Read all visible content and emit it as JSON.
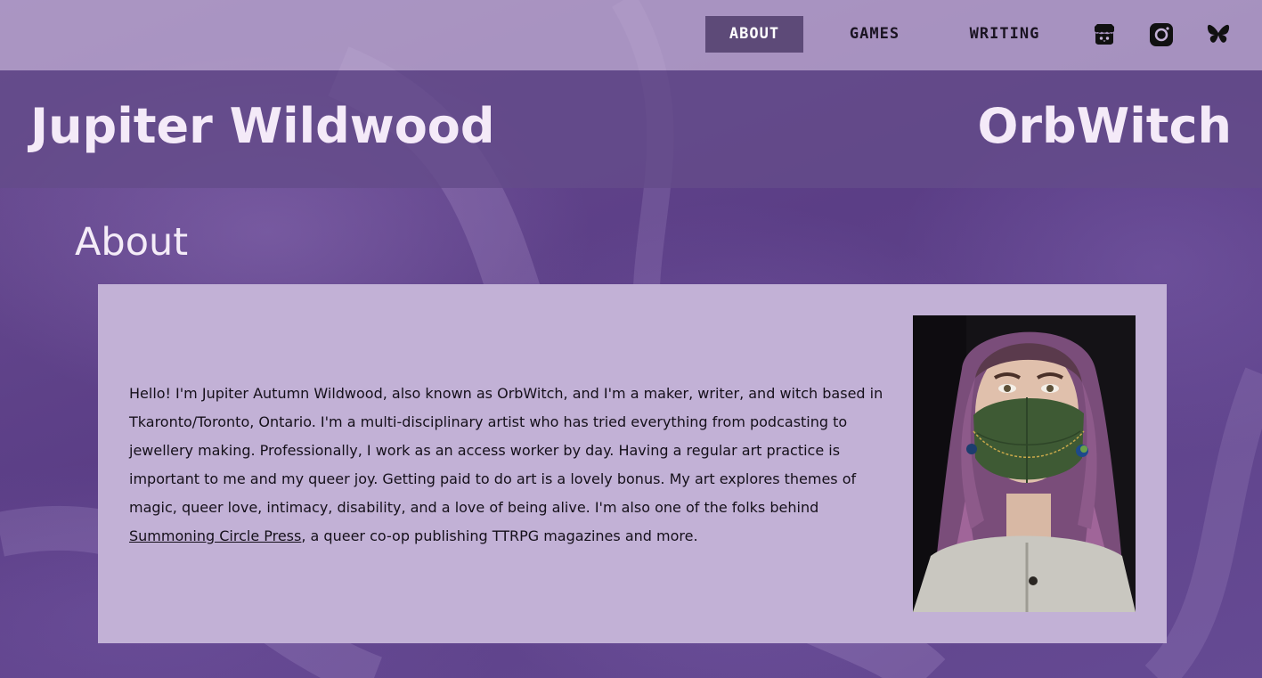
{
  "nav": {
    "items": [
      {
        "label": "ABOUT",
        "active": true
      },
      {
        "label": "GAMES",
        "active": false
      },
      {
        "label": "WRITING",
        "active": false
      }
    ],
    "social_icons": [
      "itch-io-icon",
      "instagram-icon",
      "bluesky-icon"
    ]
  },
  "banner": {
    "name": "Jupiter Wildwood",
    "alias": "OrbWitch"
  },
  "about": {
    "heading": "About",
    "paragraph": "Hello! I'm Jupiter Autumn Wildwood, also known as OrbWitch, and I'm a maker, writer, and witch based in Tkaronto/Toronto, Ontario. I'm a multi-disciplinary artist who has tried everything from podcasting to jewellery making. Professionally, I work as an access worker by day. Having a regular art practice is important to me and my queer joy. Getting paid to do art is a lovely bonus. My art explores themes of magic, queer love, intimacy, disability, and a love of being alive. I'm also one of the folks behind",
    "link_text": "Summoning Circle Press",
    "paragraph_end": ", a queer co-op publishing TTRPG magazines and more."
  },
  "colors": {
    "nav_bg": "#c4b2d6",
    "active_tab": "#5d4a78",
    "banner_bg": "#644c8a",
    "card_bg": "#c2b1d6",
    "page_bg": "#5b3e86"
  }
}
